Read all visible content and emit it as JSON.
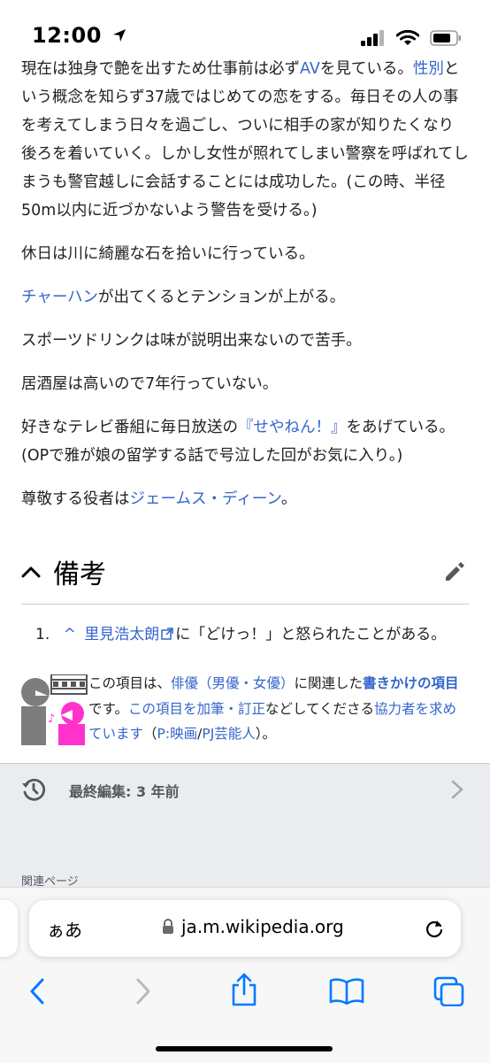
{
  "status_bar": {
    "time": "12:00"
  },
  "content": {
    "p1": {
      "t1": "現在は独身で艶を出すため仕事前は必ず",
      "link_av": "AV",
      "t2": "を見ている。",
      "link_gender": "性別",
      "t3": "という概念を知らず37歳ではじめての恋をする。毎日その人の事を考えてしまう日々を過ごし、ついに相手の家が知りたくなり後ろを着いていく。しかし女性が照れてしまい警察を呼ばれてしまうも警官越しに会話することには成功した。(この時、半径50m以内に近づかないよう警告を受ける。)"
    },
    "p2": "休日は川に綺麗な石を拾いに行っている。",
    "p3": {
      "link": "チャーハン",
      "text": "が出てくるとテンションが上がる。"
    },
    "p4": "スポーツドリンクは味が説明出来ないので苦手。",
    "p5": "居酒屋は高いので7年行っていない。",
    "p6": {
      "t1": "好きなテレビ番組に毎日放送の",
      "link": "『せやねん！』",
      "t2": "をあげている。(OPで雅が娘の留学する話で号泣した回がお気に入り。)"
    },
    "p7": {
      "t1": "尊敬する役者は",
      "link": "ジェームス・ディーン",
      "t2": "。"
    }
  },
  "section": {
    "title": "備考",
    "chevron": "chevron-up-icon",
    "edit_icon": "pencil-icon"
  },
  "references": [
    {
      "num": "1.",
      "caret": "^",
      "link": "里見浩太朗",
      "text": "に「どけっ！」と怒られたことがある。"
    }
  ],
  "stub": {
    "t1": "この項目は、",
    "link1": "俳優（男優・女優）",
    "t2": "に関連した",
    "link2": "書きかけの項目",
    "t3": "です。",
    "link3": "この項目を加筆・訂正",
    "t4": "などしてくださる",
    "link4": "協力者を求めています",
    "t5": "（",
    "link5": "P:映画",
    "t6": "/",
    "link6": "PJ芸能人",
    "t7": "）。"
  },
  "last_edited": {
    "label": "最終編集: 3 年前"
  },
  "related_pages": "関連ページ",
  "browser": {
    "aa": "ぁあ",
    "url": "ja.m.wikipedia.org"
  },
  "colors": {
    "link": "#3366cc",
    "text": "#202122",
    "gray_bg": "#eaecf0",
    "ios_blue": "#007aff",
    "stub_pink": "#ff33cc"
  }
}
